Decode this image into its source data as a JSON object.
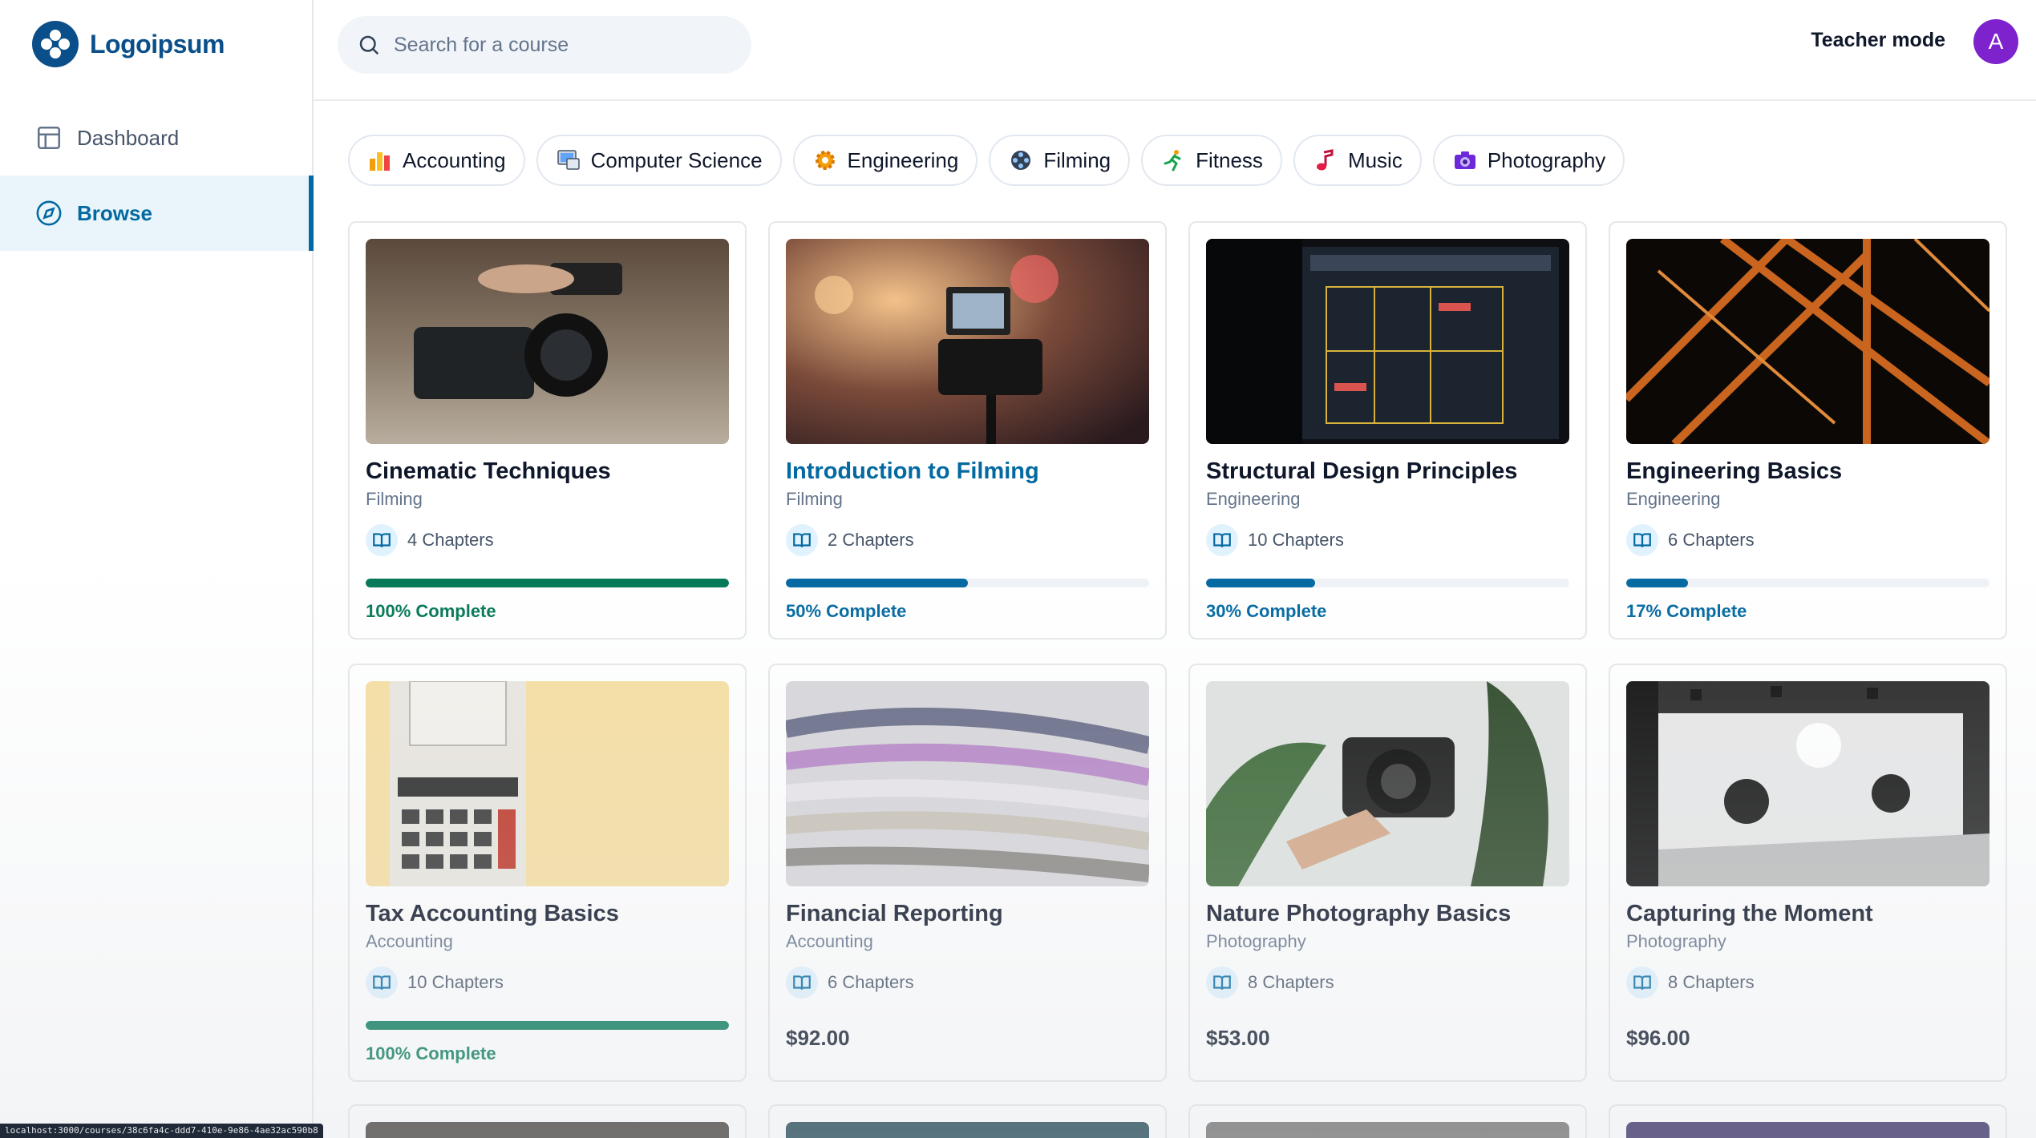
{
  "sidebar": {
    "logo_text": "Logoipsum",
    "items": [
      {
        "label": "Dashboard",
        "icon": "layout-icon",
        "active": false
      },
      {
        "label": "Browse",
        "icon": "compass-icon",
        "active": true
      }
    ]
  },
  "header": {
    "search_placeholder": "Search for a course",
    "teacher_mode_label": "Teacher mode",
    "avatar_initial": "A"
  },
  "categories": [
    {
      "label": "Accounting",
      "icon": "bar-chart-emoji-icon"
    },
    {
      "label": "Computer Science",
      "icon": "computer-emoji-icon"
    },
    {
      "label": "Engineering",
      "icon": "gear-emoji-icon"
    },
    {
      "label": "Filming",
      "icon": "film-reel-emoji-icon"
    },
    {
      "label": "Fitness",
      "icon": "runner-emoji-icon"
    },
    {
      "label": "Music",
      "icon": "music-note-emoji-icon"
    },
    {
      "label": "Photography",
      "icon": "camera-emoji-icon"
    }
  ],
  "courses": [
    {
      "title": "Cinematic Techniques",
      "category": "Filming",
      "chapters": "4 Chapters",
      "progress": 100,
      "progress_label": "100% Complete"
    },
    {
      "title": "Introduction to Filming",
      "category": "Filming",
      "chapters": "2 Chapters",
      "progress": 50,
      "progress_label": "50% Complete"
    },
    {
      "title": "Structural Design Principles",
      "category": "Engineering",
      "chapters": "10 Chapters",
      "progress": 30,
      "progress_label": "30% Complete"
    },
    {
      "title": "Engineering Basics",
      "category": "Engineering",
      "chapters": "6 Chapters",
      "progress": 17,
      "progress_label": "17% Complete"
    },
    {
      "title": "Tax Accounting Basics",
      "category": "Accounting",
      "chapters": "10 Chapters",
      "progress": 100,
      "progress_label": "100% Complete"
    },
    {
      "title": "Financial Reporting",
      "category": "Accounting",
      "chapters": "6 Chapters",
      "price": "$92.00"
    },
    {
      "title": "Nature Photography Basics",
      "category": "Photography",
      "chapters": "8 Chapters",
      "price": "$53.00"
    },
    {
      "title": "Capturing the Moment",
      "category": "Photography",
      "chapters": "8 Chapters",
      "price": "$96.00"
    }
  ],
  "status_bar_url": "localhost:3000/courses/38c6fa4c-ddd7-410e-9e86-4ae32ac590b8",
  "colors": {
    "brand": "#0b4f8a",
    "accent": "#0369a1",
    "complete": "#047857",
    "avatar": "#7e22ce"
  }
}
